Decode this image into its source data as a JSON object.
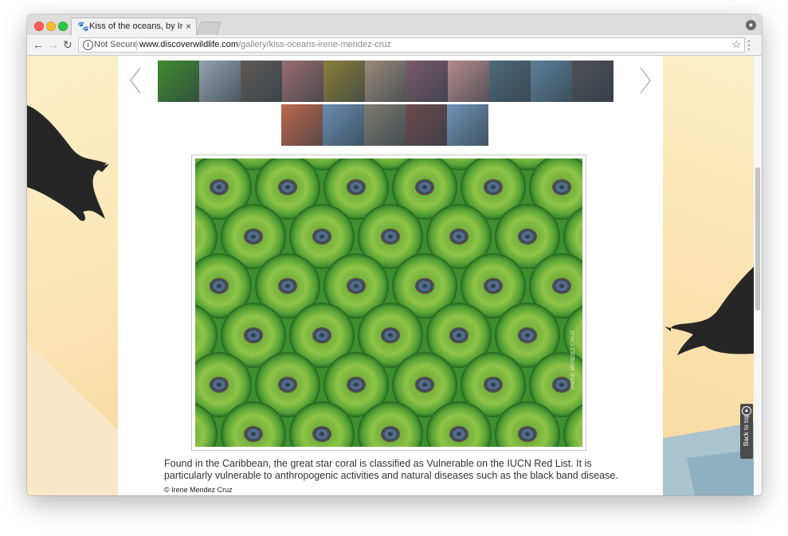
{
  "browser": {
    "tab_title": "Kiss of the oceans, by Irene M",
    "tab_close": "×",
    "favicon": "paw-icon",
    "security_label": "Not Secure",
    "url_domain": "www.discoverwildlife.com",
    "url_path": "/gallery/kiss-oceans-irene-mendez-cruz"
  },
  "gallery": {
    "thumbnails_row1": [
      {
        "name": "green-coral",
        "color": "#3f8b2e"
      },
      {
        "name": "squid",
        "color": "#93a3ad"
      },
      {
        "name": "anemone-white",
        "color": "#5f5a56"
      },
      {
        "name": "feather-star",
        "color": "#9a6e6e"
      },
      {
        "name": "yellow-coral",
        "color": "#8a7f3a"
      },
      {
        "name": "orange-fan",
        "color": "#9a8a7a"
      },
      {
        "name": "purple-urchin",
        "color": "#7a5a6a"
      },
      {
        "name": "pink-soft-coral",
        "color": "#b58a8a"
      },
      {
        "name": "reef-scene",
        "color": "#4f6a7a"
      },
      {
        "name": "blue-water-fish",
        "color": "#5d8099"
      },
      {
        "name": "dark-reef",
        "color": "#4f4f55"
      }
    ],
    "thumbnails_row2": [
      {
        "name": "red-sponge",
        "color": "#c0684c"
      },
      {
        "name": "blue-reef",
        "color": "#6a8db0"
      },
      {
        "name": "rocky-reef",
        "color": "#7d7a72"
      },
      {
        "name": "red-urchin",
        "color": "#6d4a4e"
      },
      {
        "name": "blue-open-water",
        "color": "#6f93b5"
      }
    ]
  },
  "photo": {
    "subject": "great star coral close-up",
    "watermark": "IRENE MENDEZ CRUZ"
  },
  "caption": "Found in the Caribbean, the great star coral is classified as Vulnerable on the IUCN Red List. It is particularly vulnerable to anthropogenic activities and natural diseases such as the black band disease.",
  "credit": "© Irene Mendez Cruz",
  "back_to_top": "Back to top"
}
